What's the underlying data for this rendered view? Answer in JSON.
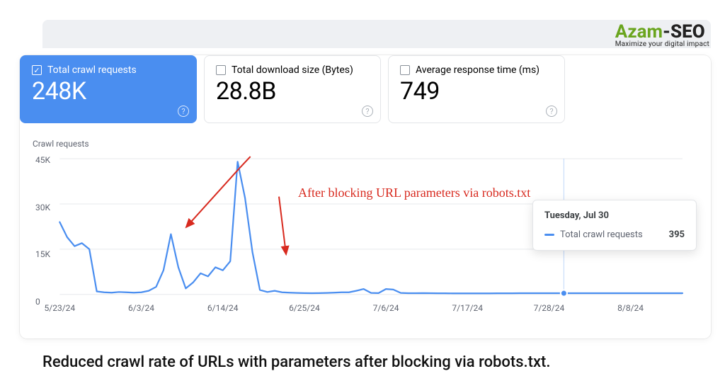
{
  "logo": {
    "a": "Azam",
    "b": "-SEO",
    "sub": "Maximize your digital impact"
  },
  "tiles": [
    {
      "label": "Total crawl requests",
      "value": "248K",
      "active": true
    },
    {
      "label": "Total download size (Bytes)",
      "value": "28.8B",
      "active": false
    },
    {
      "label": "Average response time (ms)",
      "value": "749",
      "active": false
    }
  ],
  "annotation_text": "After blocking URL parameters via robots.txt",
  "tooltip": {
    "title": "Tuesday, Jul 30",
    "series": "Total crawl requests",
    "value": "395"
  },
  "caption": "Reduced crawl rate of URLs with parameters after blocking via robots.txt.",
  "chart_data": {
    "type": "line",
    "title": "Crawl requests",
    "ylabel": "",
    "xlabel": "",
    "ylim": [
      0,
      45000
    ],
    "y_ticks": [
      0,
      15000,
      30000,
      45000
    ],
    "y_tick_labels": [
      "0",
      "15K",
      "30K",
      "45K"
    ],
    "x_tick_labels": [
      "5/23/24",
      "6/3/24",
      "6/14/24",
      "6/25/24",
      "7/6/24",
      "7/17/24",
      "7/28/24",
      "8/8/24"
    ],
    "categories": [
      "5/23/24",
      "5/24/24",
      "5/25/24",
      "5/26/24",
      "5/27/24",
      "5/28/24",
      "5/29/24",
      "5/30/24",
      "5/31/24",
      "6/1/24",
      "6/2/24",
      "6/3/24",
      "6/4/24",
      "6/5/24",
      "6/6/24",
      "6/7/24",
      "6/8/24",
      "6/9/24",
      "6/10/24",
      "6/11/24",
      "6/12/24",
      "6/13/24",
      "6/14/24",
      "6/15/24",
      "6/16/24",
      "6/17/24",
      "6/18/24",
      "6/19/24",
      "6/20/24",
      "6/21/24",
      "6/22/24",
      "6/23/24",
      "6/24/24",
      "6/25/24",
      "6/26/24",
      "6/27/24",
      "6/28/24",
      "6/29/24",
      "6/30/24",
      "7/1/24",
      "7/2/24",
      "7/3/24",
      "7/4/24",
      "7/5/24",
      "7/6/24",
      "7/7/24",
      "7/8/24",
      "7/9/24",
      "7/10/24",
      "7/11/24",
      "7/12/24",
      "7/13/24",
      "7/14/24",
      "7/15/24",
      "7/16/24",
      "7/17/24",
      "7/18/24",
      "7/19/24",
      "7/20/24",
      "7/21/24",
      "7/22/24",
      "7/23/24",
      "7/24/24",
      "7/25/24",
      "7/26/24",
      "7/27/24",
      "7/28/24",
      "7/29/24",
      "7/30/24",
      "7/31/24",
      "8/1/24",
      "8/2/24",
      "8/3/24",
      "8/4/24",
      "8/5/24",
      "8/6/24",
      "8/7/24",
      "8/8/24",
      "8/9/24",
      "8/10/24",
      "8/11/24",
      "8/12/24",
      "8/13/24",
      "8/14/24",
      "8/15/24"
    ],
    "series": [
      {
        "name": "Total crawl requests",
        "values": [
          24000,
          19000,
          16000,
          17000,
          15000,
          1000,
          700,
          600,
          800,
          700,
          600,
          700,
          1200,
          2500,
          8000,
          20000,
          9000,
          2000,
          4000,
          7000,
          6000,
          9000,
          8000,
          11000,
          44000,
          32000,
          14000,
          1500,
          800,
          1200,
          700,
          600,
          500,
          450,
          400,
          450,
          500,
          600,
          700,
          700,
          1200,
          1800,
          500,
          450,
          1800,
          1600,
          500,
          400,
          400,
          450,
          400,
          380,
          380,
          360,
          350,
          350,
          350,
          350,
          360,
          370,
          380,
          390,
          400,
          400,
          400,
          400,
          400,
          395,
          395,
          400,
          400,
          400,
          400,
          400,
          400,
          400,
          400,
          400,
          400,
          400,
          400,
          400,
          400,
          400,
          400
        ]
      }
    ],
    "highlight_index": 68
  }
}
